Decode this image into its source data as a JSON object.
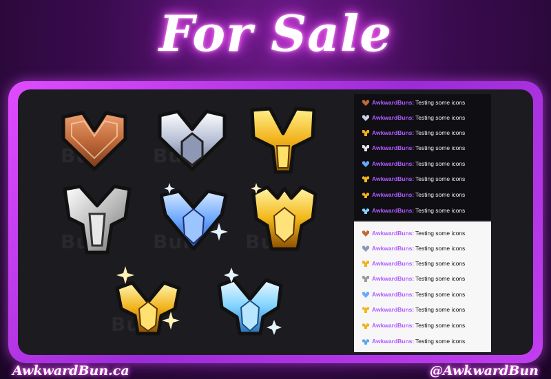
{
  "title": "For Sale",
  "watermark": "Bun",
  "badges": [
    {
      "name": "bronze",
      "icon": "bronze-chevron-icon"
    },
    {
      "name": "silver",
      "icon": "silver-chevron-icon"
    },
    {
      "name": "gold",
      "icon": "gold-wing-icon"
    },
    {
      "name": "platinum",
      "icon": "platinum-wing-icon"
    },
    {
      "name": "diamond",
      "icon": "diamond-sparkle-icon"
    },
    {
      "name": "champion",
      "icon": "champion-crown-icon"
    },
    {
      "name": "grand-gold",
      "icon": "grand-gold-sparkle-icon"
    },
    {
      "name": "grand-diamond",
      "icon": "grand-diamond-sparkle-icon"
    }
  ],
  "chat": {
    "username": "AwkwardBuns",
    "separator": ":",
    "message": "Testing some icons",
    "username_color": "#b05cff",
    "icons": [
      "bronze",
      "silver",
      "gold",
      "platinum",
      "diamond",
      "champion",
      "grand-gold",
      "grand-diamond"
    ]
  },
  "footer": {
    "left": "AwkwardBun.ca",
    "right": "@AwkwardBun"
  },
  "colors": {
    "accent": "#d63bff",
    "bronze": "#c06a3a",
    "silver": "#c9d2e6",
    "gold": "#f1b21b",
    "platinum": "#e6e6e6",
    "diamond": "#6aa7ff",
    "champion": "#f3b81a",
    "ice": "#7fd3ff"
  }
}
